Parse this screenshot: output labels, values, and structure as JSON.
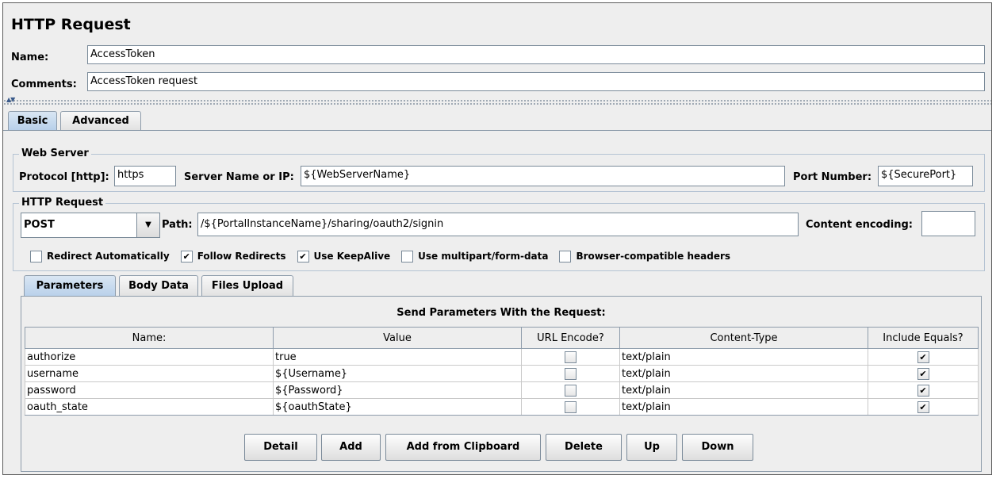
{
  "panel_title": "HTTP Request",
  "name": {
    "label": "Name:",
    "value": "AccessToken"
  },
  "comments": {
    "label": "Comments:",
    "value": "AccessToken request"
  },
  "main_tabs": [
    {
      "label": "Basic",
      "selected": true
    },
    {
      "label": "Advanced",
      "selected": false
    }
  ],
  "web_server": {
    "title": "Web Server",
    "protocol_label": "Protocol [http]:",
    "protocol_value": "https",
    "server_label": "Server Name or IP:",
    "server_value": "${WebServerName}",
    "port_label": "Port Number:",
    "port_value": "${SecurePort}"
  },
  "http_request": {
    "title": "HTTP Request",
    "method": "POST",
    "path_label": "Path:",
    "path_value": "/${PortalInstanceName}/sharing/oauth2/signin",
    "encoding_label": "Content encoding:",
    "encoding_value": ""
  },
  "options": [
    {
      "label": "Redirect Automatically",
      "checked": false
    },
    {
      "label": "Follow Redirects",
      "checked": true
    },
    {
      "label": "Use KeepAlive",
      "checked": true
    },
    {
      "label": "Use multipart/form-data",
      "checked": false
    },
    {
      "label": "Browser-compatible headers",
      "checked": false
    }
  ],
  "sub_tabs": [
    {
      "label": "Parameters",
      "selected": true
    },
    {
      "label": "Body Data",
      "selected": false
    },
    {
      "label": "Files Upload",
      "selected": false
    }
  ],
  "params_table": {
    "title": "Send Parameters With the Request:",
    "columns": [
      "Name:",
      "Value",
      "URL Encode?",
      "Content-Type",
      "Include Equals?"
    ],
    "rows": [
      {
        "name": "authorize",
        "value": "true",
        "url_encode": false,
        "content_type": "text/plain",
        "include_equals": true
      },
      {
        "name": "username",
        "value": "${Username}",
        "url_encode": false,
        "content_type": "text/plain",
        "include_equals": true
      },
      {
        "name": "password",
        "value": "${Password}",
        "url_encode": false,
        "content_type": "text/plain",
        "include_equals": true
      },
      {
        "name": "oauth_state",
        "value": "${oauthState}",
        "url_encode": false,
        "content_type": "text/plain",
        "include_equals": true
      }
    ]
  },
  "buttons": {
    "detail": "Detail",
    "add": "Add",
    "add_clipboard": "Add from Clipboard",
    "delete": "Delete",
    "up": "Up",
    "down": "Down"
  },
  "check_glyph": "✔"
}
